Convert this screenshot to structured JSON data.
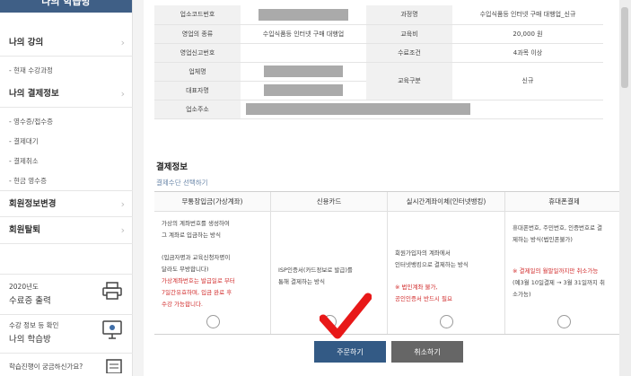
{
  "sidebar": {
    "header": "나의 학습방",
    "menu": {
      "lecture": "나의 강의",
      "lecture_sub": "- 현재 수강과정",
      "payment": "나의 결제정보",
      "payment_subs": [
        "- 영수증/접수증",
        "- 결제대기",
        "- 결제취소",
        "- 현금 영수증"
      ],
      "member_edit": "회원정보변경",
      "withdraw": "회원탈퇴"
    },
    "cards": [
      {
        "small": "2020년도",
        "big": "수료증 출력"
      },
      {
        "small": "수강 정보 등 확인",
        "big": "나의 학습방"
      },
      {
        "small": "학습진행이 궁금하신가요?",
        "big": ""
      }
    ]
  },
  "info_table": {
    "biz_code_label": "업소코드번호",
    "course_label": "과정명",
    "course_value": "수입식품등 인터넷 구매 대행업_신규",
    "biz_type_label": "영업의 종류",
    "biz_type_value": "수입식품등 인터넷 구매 대행업",
    "fee_label": "교육비",
    "fee_value": "20,000 원",
    "report_no_label": "영업신고번호",
    "complete_label": "수료조건",
    "complete_value": "4과목 이상",
    "company_label": "업체명",
    "edu_type_label": "교육구분",
    "edu_type_value": "신규",
    "rep_label": "대표자명",
    "address_label": "업소주소"
  },
  "payment": {
    "title": "결제정보",
    "subtitle": "결제수단 선택하기",
    "methods": [
      {
        "name": "무통장입금(가상계좌)",
        "desc1": "가상의 계좌번호를 생성하여\n그 계좌로 입금하는 방식",
        "desc2": "(입금자명과 교육신청자명이\n달라도 무방합니다)",
        "red": "가상계좌번호는 발급일로 부터\n7일간유효하며, 입금 완료 후\n수강 가능합니다."
      },
      {
        "name": "신용카드",
        "desc1": "ISP인증서(카드정보로 발급)를\n통해 결제하는 방식",
        "desc2": "",
        "red": ""
      },
      {
        "name": "실시간계좌이체(인터넷뱅킹)",
        "desc1": "회원가입자의 계좌에서\n인터넷뱅킹으로 결제하는 방식",
        "desc2": "",
        "red": "※ 법인계좌 불가,\n공인인증서 반드시 필요"
      },
      {
        "name": "휴대폰결제",
        "desc1": "휴대폰번호, 주민번호, 인증번호로 결\n제하는 방식(법인폰불가)",
        "desc2": "",
        "red": "※ 결제일의 월말일까지만 취소가능",
        "note": "(예3월 10일결제 → 3월 31일까지 취\n소가능)"
      }
    ]
  },
  "buttons": {
    "order": "주문하기",
    "cancel": "취소하기"
  },
  "colors": {
    "primary": "#335a85",
    "header": "#3f5f86",
    "accent_red": "#d12b2b"
  }
}
